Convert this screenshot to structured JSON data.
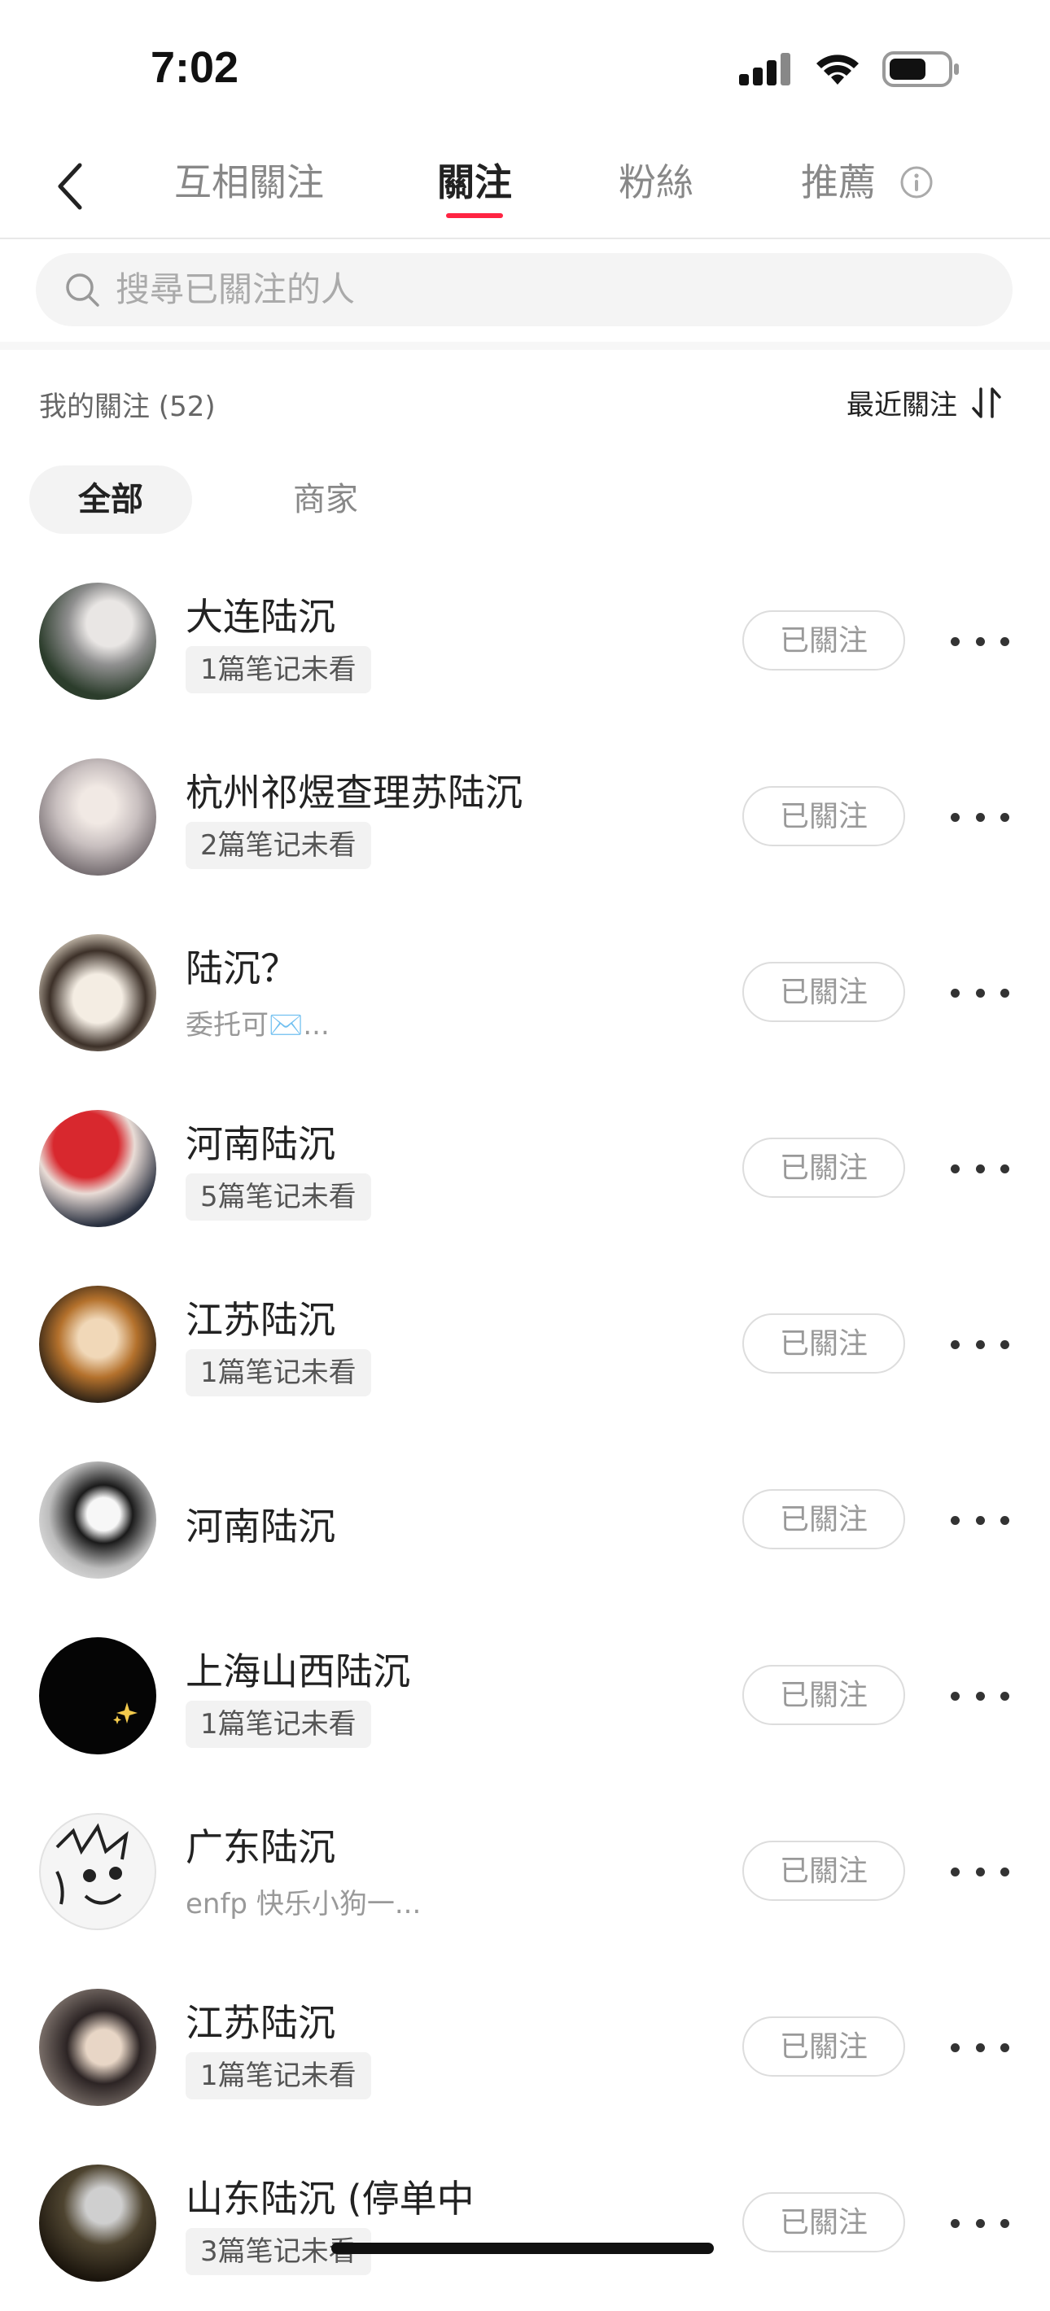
{
  "status_bar": {
    "time": "7:02"
  },
  "nav": {
    "tabs": [
      {
        "label": "互相關注",
        "active": false
      },
      {
        "label": "關注",
        "active": true
      },
      {
        "label": "粉絲",
        "active": false
      },
      {
        "label": "推薦",
        "active": false
      }
    ]
  },
  "search": {
    "placeholder": "搜尋已關注的人"
  },
  "summary": {
    "following_count": "我的關注 (52)",
    "sort_label": "最近關注"
  },
  "filters": {
    "all": "全部",
    "merchant": "商家"
  },
  "following_list": [
    {
      "name": "大连陆沉",
      "badge": "1篇笔记未看",
      "subtitle": "",
      "button": "已關注",
      "avatar_color": "#3a3f3a"
    },
    {
      "name": "杭州祁煜查理苏陆沉",
      "badge": "2篇笔记未看",
      "subtitle": "",
      "button": "已關注",
      "avatar_color": "#a59a98"
    },
    {
      "name": "陆沉？",
      "badge": "",
      "subtitle": "委托可✉️...",
      "button": "已關注",
      "avatar_color": "#d9cdb8"
    },
    {
      "name": "河南陆沉",
      "badge": "5篇笔记未看",
      "subtitle": "",
      "button": "已關注",
      "avatar_color": "#c8202a"
    },
    {
      "name": "江苏陆沉",
      "badge": "1篇笔记未看",
      "subtitle": "",
      "button": "已關注",
      "avatar_color": "#a8652d"
    },
    {
      "name": "河南陆沉",
      "badge": "",
      "subtitle": "",
      "button": "已關注",
      "avatar_color": "#d0d0d0"
    },
    {
      "name": "上海山西陆沉",
      "badge": "1篇笔记未看",
      "subtitle": "",
      "button": "已關注",
      "avatar_color": "#050505"
    },
    {
      "name": "广东陆沉",
      "badge": "",
      "subtitle": "enfp 快乐小狗一...",
      "button": "已關注",
      "avatar_color": "#eeeeee"
    },
    {
      "name": "江苏陆沉",
      "badge": "1篇笔记未看",
      "subtitle": "",
      "button": "已關注",
      "avatar_color": "#4a3f3c"
    },
    {
      "name": "山东陆沉 (停单中",
      "badge": "3篇笔记未看",
      "subtitle": "",
      "button": "已關注",
      "avatar_color": "#2c261c"
    }
  ],
  "colors": {
    "accent": "#ff2442"
  }
}
